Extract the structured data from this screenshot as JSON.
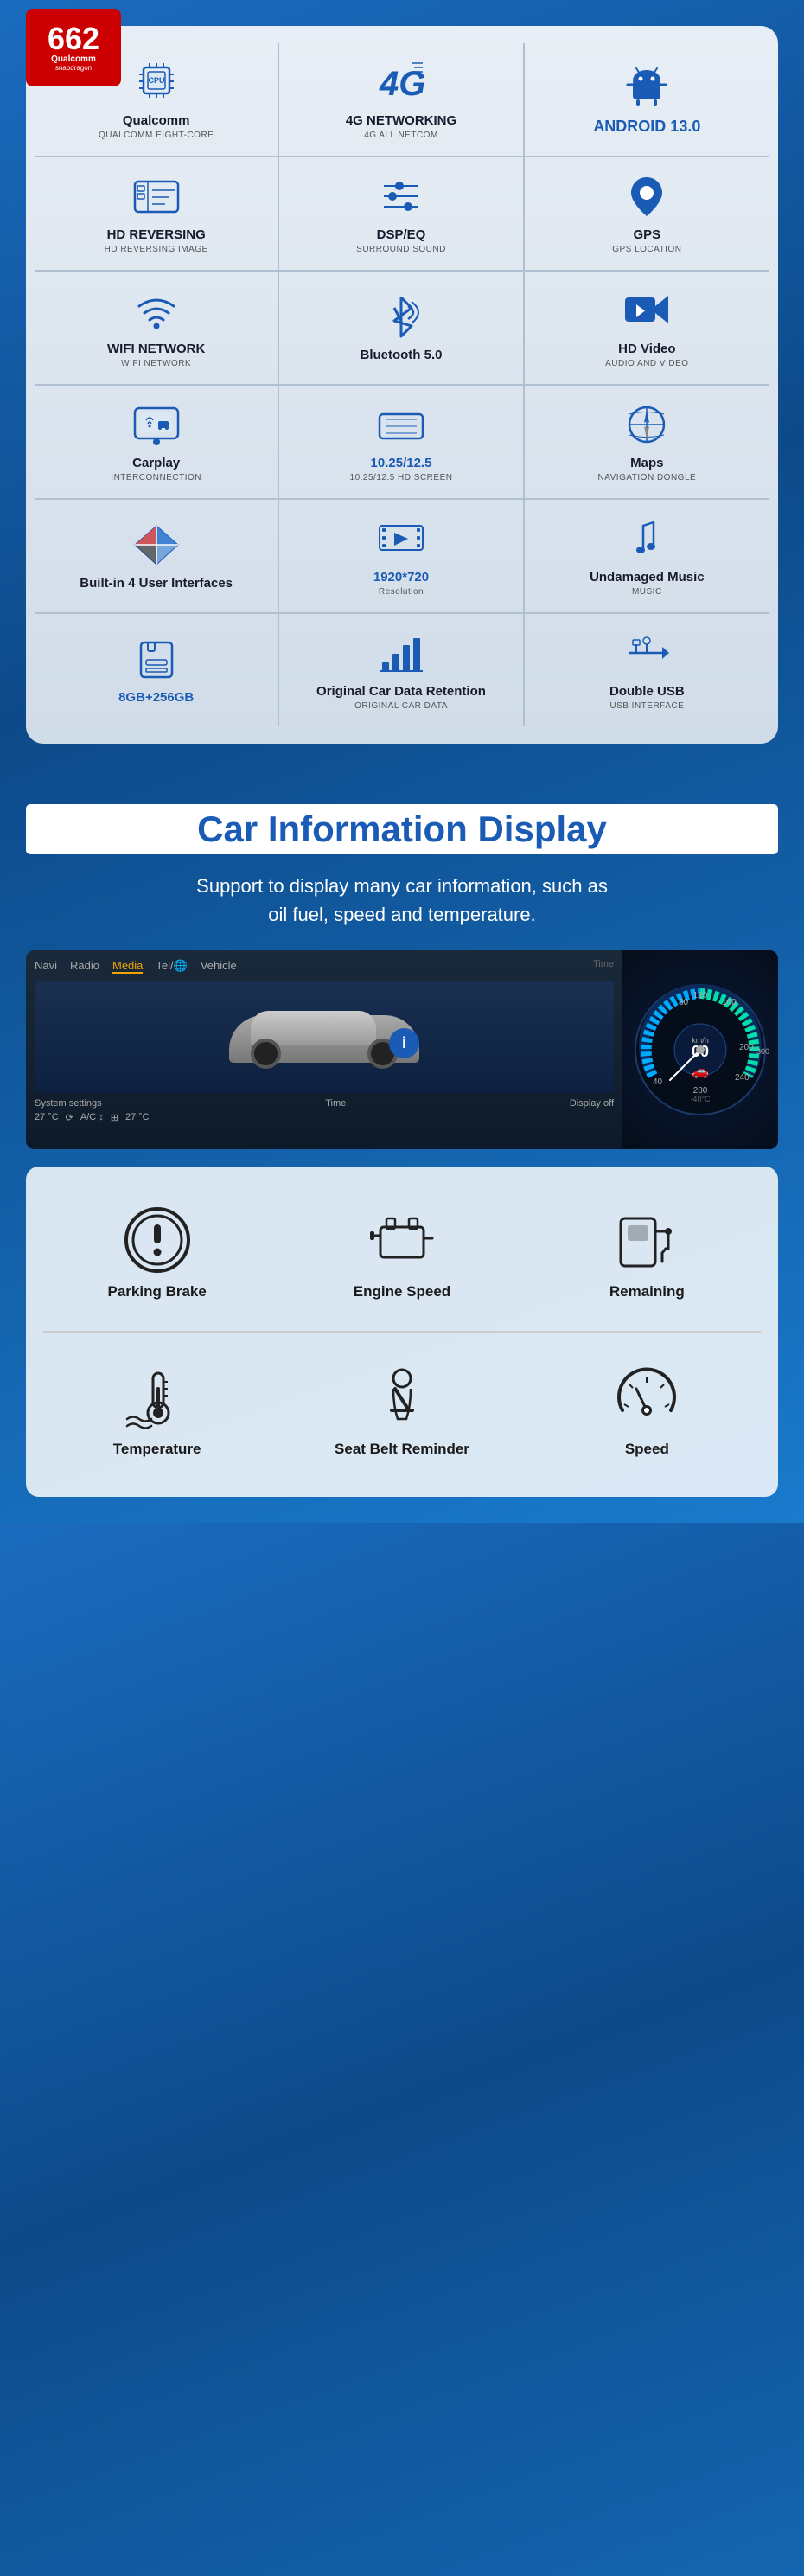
{
  "badge": {
    "number": "662",
    "brand": "Qualcomm",
    "sub": "snapdragon"
  },
  "features": [
    {
      "id": "qualcomm",
      "title": "Qualcomm",
      "subtitle": "QUALCOMM EIGHT-CORE",
      "icon": "cpu",
      "blue": false
    },
    {
      "id": "4g",
      "title": "4G NETWORKING",
      "subtitle": "4G ALL NETCOM",
      "icon": "4g",
      "blue": false
    },
    {
      "id": "android",
      "title": "ANDROID 13.0",
      "subtitle": "",
      "icon": "android",
      "blue": true
    },
    {
      "id": "hd-reversing",
      "title": "HD REVERSING",
      "subtitle": "HD REVERSING IMAGE",
      "icon": "reversing",
      "blue": false
    },
    {
      "id": "dsp",
      "title": "DSP/EQ",
      "subtitle": "SURROUND SOUND",
      "icon": "dsp",
      "blue": false
    },
    {
      "id": "gps",
      "title": "GPS",
      "subtitle": "GPS LOCATION",
      "icon": "gps",
      "blue": false
    },
    {
      "id": "wifi",
      "title": "WIFI NETWORK",
      "subtitle": "WIFI NETWORK",
      "icon": "wifi",
      "blue": false
    },
    {
      "id": "bluetooth",
      "title": "Bluetooth 5.0",
      "subtitle": "",
      "icon": "bluetooth",
      "blue": false
    },
    {
      "id": "hdvideo",
      "title": "HD Video",
      "subtitle": "AUDIO AND VIDEO",
      "icon": "video",
      "blue": false
    },
    {
      "id": "carplay",
      "title": "Carplay",
      "subtitle": "INTERCONNECTION",
      "icon": "carplay",
      "blue": false
    },
    {
      "id": "screen",
      "title": "10.25/12.5",
      "subtitle": "10.25/12.5 HD SCREEN",
      "icon": "screen",
      "blue": true
    },
    {
      "id": "maps",
      "title": "Maps",
      "subtitle": "NAVIGATION DONGLE",
      "icon": "maps",
      "blue": false
    },
    {
      "id": "builtin",
      "title": "Built-in 4 User Interfaces",
      "subtitle": "",
      "icon": "interfaces",
      "blue": false
    },
    {
      "id": "resolution",
      "title": "1920*720",
      "subtitle": "Resolution",
      "icon": "resolution",
      "blue": true
    },
    {
      "id": "music",
      "title": "Undamaged Music",
      "subtitle": "MUSIC",
      "icon": "music",
      "blue": false
    },
    {
      "id": "storage",
      "title": "8GB+256GB",
      "subtitle": "",
      "icon": "storage",
      "blue": true
    },
    {
      "id": "cardata",
      "title": "Original Car Data Retention",
      "subtitle": "ORIGINAL CAR DATA",
      "icon": "cardata",
      "blue": false
    },
    {
      "id": "usb",
      "title": "Double USB",
      "subtitle": "USB INTERFACE",
      "icon": "usb",
      "blue": false
    }
  ],
  "carInfo": {
    "title": "Car Information Display",
    "description": "Support to display many car information, such as\noil fuel, speed and temperature.",
    "dashboard": {
      "navItems": [
        "Navi",
        "Radio",
        "Media",
        "Tel/🌐",
        "Vehicle"
      ],
      "activeNav": "Media",
      "bottomItems": [
        "System settings",
        "Time",
        "Display off"
      ],
      "temp1": "27 °C",
      "temp2": "27 °C",
      "ac": "A/C ↕"
    },
    "infoIcons": [
      {
        "id": "parking-brake",
        "label": "Parking Brake",
        "icon": "parking"
      },
      {
        "id": "engine-speed",
        "label": "Engine Speed",
        "icon": "engine"
      },
      {
        "id": "remaining",
        "label": "Remaining",
        "icon": "fuel"
      },
      {
        "id": "temperature",
        "label": "Temperature",
        "icon": "temperature"
      },
      {
        "id": "seatbelt",
        "label": "Seat Belt Reminder",
        "icon": "seatbelt"
      },
      {
        "id": "speed",
        "label": "Speed",
        "icon": "speedometer"
      }
    ]
  }
}
